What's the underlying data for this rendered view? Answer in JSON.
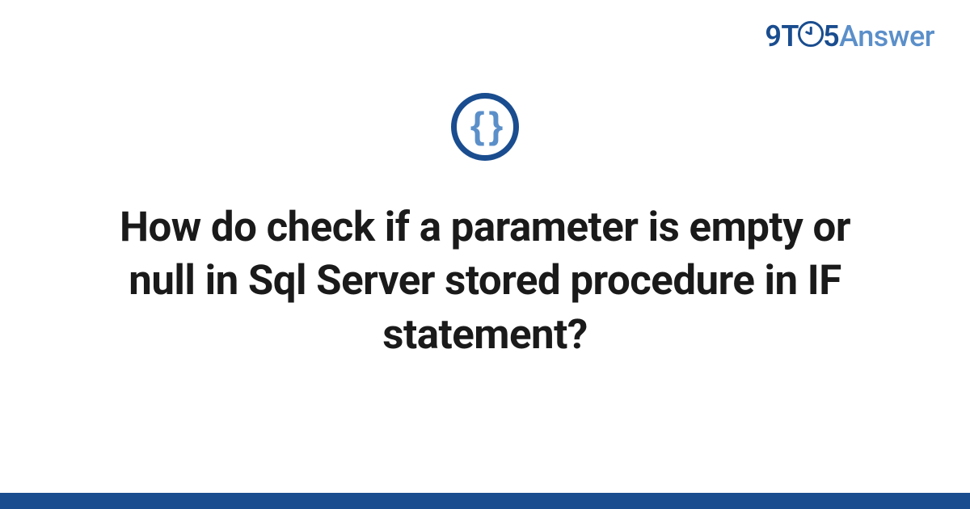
{
  "logo": {
    "part1": "9T",
    "part2": "5",
    "part3": "Answer"
  },
  "category_icon": {
    "symbol": "{ }",
    "name": "code-braces"
  },
  "question": {
    "title": "How do check if a parameter is empty or null in Sql Server stored procedure in IF statement?"
  },
  "colors": {
    "primary": "#1a4d8f",
    "secondary": "#5b8fc9",
    "text": "#1a1a1a"
  }
}
